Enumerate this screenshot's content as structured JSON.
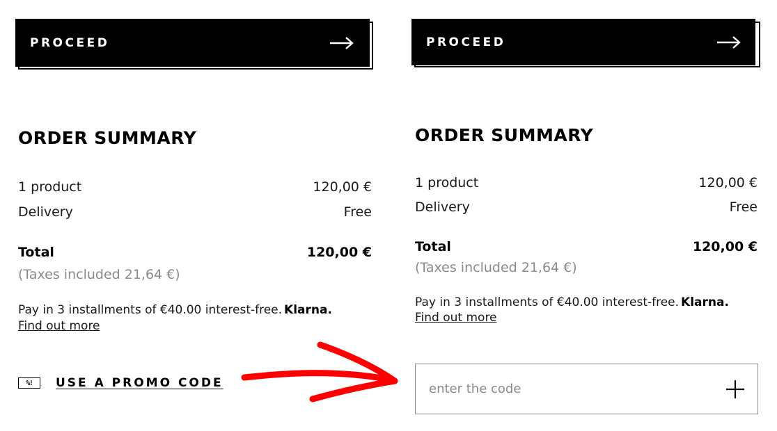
{
  "left": {
    "proceed_label": "PROCEED",
    "summary_title": "ORDER SUMMARY",
    "rows": [
      {
        "label": "1 product",
        "value": "120,00 €"
      },
      {
        "label": "Delivery",
        "value": "Free"
      }
    ],
    "total_label": "Total",
    "total_value": "120,00 €",
    "taxes": "(Taxes included 21,64 €)",
    "installments": "Pay in 3 installments of €40.00 interest-free.",
    "klarna": "Klarna.",
    "find_out_more": "Find out more",
    "promo_icon_text": "%⁝",
    "promo_label": "USE A PROMO CODE"
  },
  "right": {
    "proceed_label": "PROCEED",
    "summary_title": "ORDER SUMMARY",
    "rows": [
      {
        "label": "1 product",
        "value": "120,00 €"
      },
      {
        "label": "Delivery",
        "value": "Free"
      }
    ],
    "total_label": "Total",
    "total_value": "120,00 €",
    "taxes": "(Taxes included 21,64 €)",
    "installments": "Pay in 3 installments of €40.00 interest-free.",
    "klarna": "Klarna.",
    "find_out_more": "Find out more",
    "code_placeholder": "enter the code"
  },
  "icons": {
    "proceed": "arrow-right-icon",
    "add_code": "plus-icon",
    "promo": "percent-tag-icon",
    "annotation": "red-annotation-arrow"
  },
  "colors": {
    "button_bg": "#000000",
    "button_text": "#ffffff",
    "muted_text": "#8a8a8a",
    "annotation_red": "#ff0000"
  }
}
